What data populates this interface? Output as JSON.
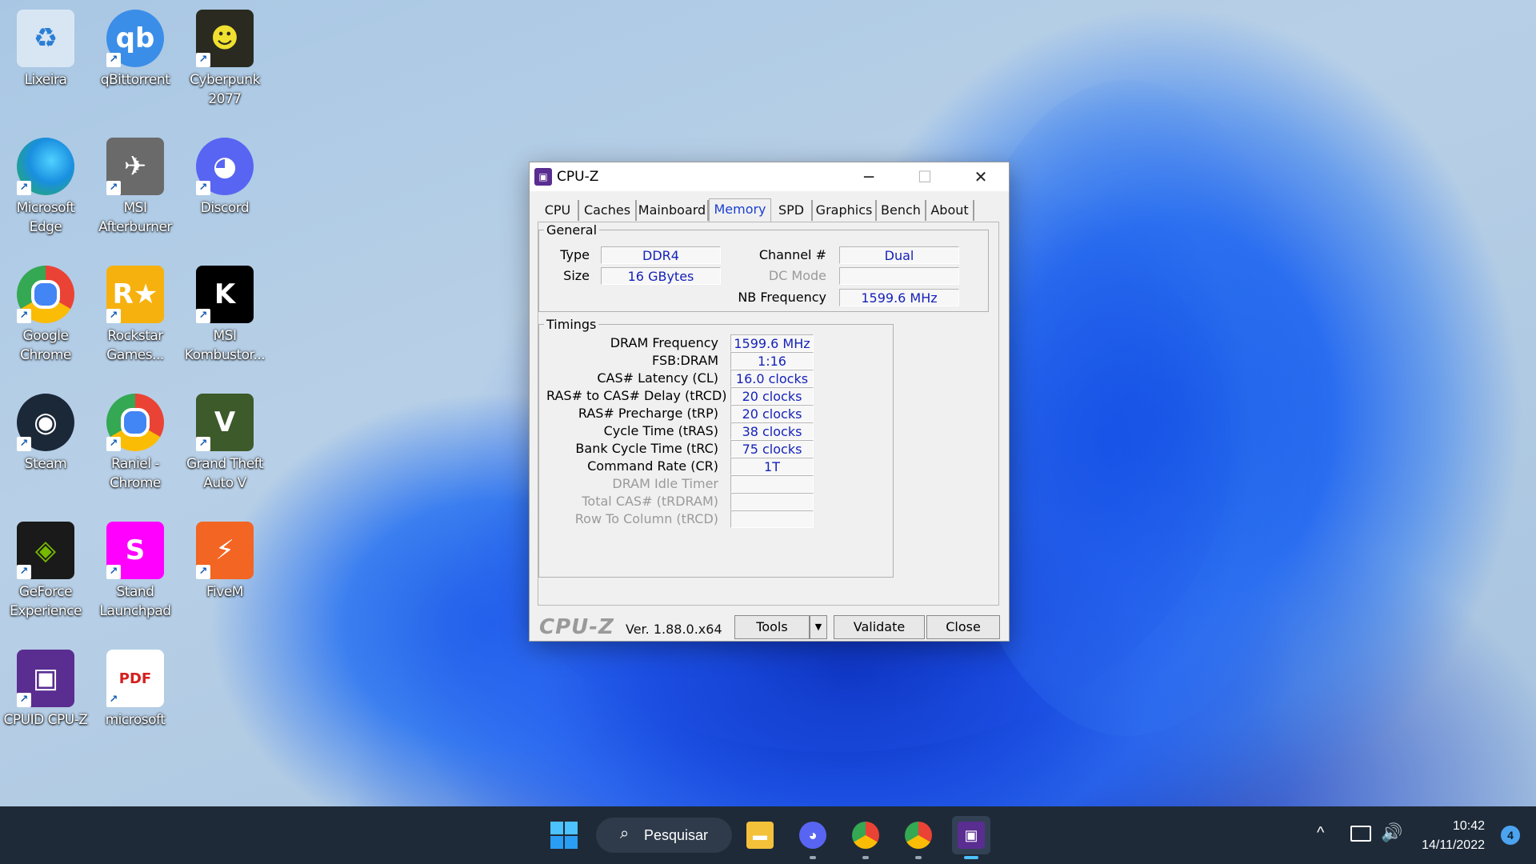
{
  "desktop": {
    "icons": [
      {
        "label": "Lixeira",
        "icon": "recycle-bin-icon",
        "color": "#d8e6f4"
      },
      {
        "label": "qBittorrent",
        "icon": "qbittorrent-icon",
        "color": "#3b8ee8"
      },
      {
        "label": "Cyberpunk 2077",
        "icon": "cyberpunk-icon",
        "color": "#2a2a20"
      },
      {
        "label": "Microsoft Edge",
        "icon": "edge-icon",
        "color": "#1aa3a3"
      },
      {
        "label": "MSI Afterburner",
        "icon": "msi-afterburner-icon",
        "color": "#6a6a6a"
      },
      {
        "label": "Discord",
        "icon": "discord-icon",
        "color": "#5865f2"
      },
      {
        "label": "Google Chrome",
        "icon": "chrome-icon",
        "color": "#e23f2f"
      },
      {
        "label": "Rockstar Games...",
        "icon": "rockstar-icon",
        "color": "#f6b10e"
      },
      {
        "label": "MSI Kombustor...",
        "icon": "kombustor-icon",
        "color": "#000000"
      },
      {
        "label": "Steam",
        "icon": "steam-icon",
        "color": "#1b2838"
      },
      {
        "label": "Raniel - Chrome",
        "icon": "chrome-profile-icon",
        "color": "#e23f2f"
      },
      {
        "label": "Grand Theft Auto V",
        "icon": "gta-v-icon",
        "color": "#3d5a2a"
      },
      {
        "label": "GeForce Experience",
        "icon": "geforce-icon",
        "color": "#76b900"
      },
      {
        "label": "Stand Launchpad",
        "icon": "stand-icon",
        "color": "#ff00ff"
      },
      {
        "label": "FiveM",
        "icon": "fivem-icon",
        "color": "#f26522"
      },
      {
        "label": "CPUID CPU-Z",
        "icon": "cpuz-icon",
        "color": "#5a2d91"
      },
      {
        "label": "microsoft",
        "icon": "pdf-icon",
        "color": "#ffffff"
      }
    ],
    "glyphs": {
      "qbittorrent": "qb",
      "discord": "◕",
      "rockstar": "R★",
      "kombustor": "K",
      "steam": "◉",
      "gta": "V",
      "stand": "S",
      "fivem": "⚡",
      "pdf": "PDF",
      "cpuz": "▣"
    }
  },
  "window": {
    "title": "CPU-Z",
    "minimize": "─",
    "maximize": "☐",
    "close": "✕",
    "tabs": [
      "CPU",
      "Caches",
      "Mainboard",
      "Memory",
      "SPD",
      "Graphics",
      "Bench",
      "About"
    ],
    "active_tab": "Memory",
    "general": {
      "legend": "General",
      "type_label": "Type",
      "type_value": "DDR4",
      "size_label": "Size",
      "size_value": "16 GBytes",
      "channel_label": "Channel #",
      "channel_value": "Dual",
      "dcmode_label": "DC Mode",
      "dcmode_value": "",
      "nbfreq_label": "NB Frequency",
      "nbfreq_value": "1599.6 MHz"
    },
    "timings": {
      "legend": "Timings",
      "rows": [
        {
          "label": "DRAM Frequency",
          "value": "1599.6 MHz",
          "enabled": true
        },
        {
          "label": "FSB:DRAM",
          "value": "1:16",
          "enabled": true
        },
        {
          "label": "CAS# Latency (CL)",
          "value": "16.0 clocks",
          "enabled": true
        },
        {
          "label": "RAS# to CAS# Delay (tRCD)",
          "value": "20 clocks",
          "enabled": true
        },
        {
          "label": "RAS# Precharge (tRP)",
          "value": "20 clocks",
          "enabled": true
        },
        {
          "label": "Cycle Time (tRAS)",
          "value": "38 clocks",
          "enabled": true
        },
        {
          "label": "Bank Cycle Time (tRC)",
          "value": "75 clocks",
          "enabled": true
        },
        {
          "label": "Command Rate (CR)",
          "value": "1T",
          "enabled": true
        },
        {
          "label": "DRAM Idle Timer",
          "value": "",
          "enabled": false
        },
        {
          "label": "Total CAS# (tRDRAM)",
          "value": "",
          "enabled": false
        },
        {
          "label": "Row To Column (tRCD)",
          "value": "",
          "enabled": false
        }
      ]
    },
    "footer": {
      "brand": "CPU-Z",
      "version": "Ver. 1.88.0.x64",
      "tools": "Tools",
      "tools_arrow": "▼",
      "validate": "Validate",
      "close": "Close"
    }
  },
  "taskbar": {
    "start_icon": "windows-start-icon",
    "search_label": "Pesquisar",
    "apps": [
      {
        "icon": "file-explorer-icon",
        "color": "#f3c13a"
      },
      {
        "icon": "discord-icon",
        "color": "#5865f2"
      },
      {
        "icon": "chrome-profile-icon",
        "color": "#e23f2f"
      },
      {
        "icon": "chrome-icon",
        "color": "#e23f2f"
      },
      {
        "icon": "cpuz-icon",
        "color": "#5a2d91"
      }
    ],
    "tray": {
      "chevron": "^",
      "time": "10:42",
      "date": "14/11/2022",
      "notifications": "4"
    }
  }
}
